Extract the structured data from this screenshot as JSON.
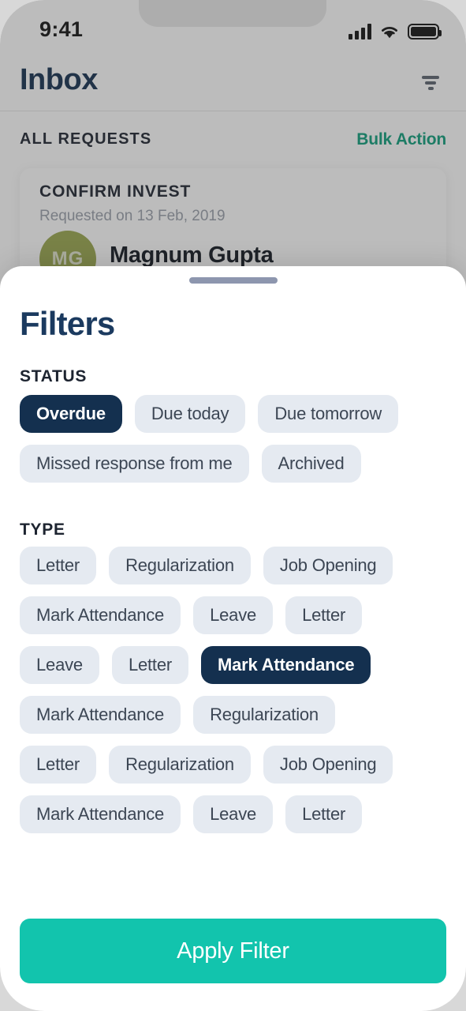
{
  "statusbar": {
    "time": "9:41",
    "signal_icon": "cellular-signal-icon",
    "wifi_icon": "wifi-icon",
    "battery_icon": "battery-icon"
  },
  "inbox": {
    "title": "Inbox",
    "filter_icon": "filter-funnel-icon",
    "list_label": "ALL REQUESTS",
    "bulk_action_label": "Bulk Action",
    "card": {
      "title": "CONFIRM INVEST",
      "subtitle": "Requested on 13 Feb, 2019",
      "avatar_initials": "MG",
      "name": "Magnum Gupta"
    }
  },
  "sheet": {
    "handle": "drag-handle",
    "title": "Filters",
    "sections": [
      {
        "label": "STATUS",
        "rows": [
          [
            {
              "label": "Overdue",
              "selected": true
            },
            {
              "label": "Due today",
              "selected": false
            },
            {
              "label": "Due tomorrow",
              "selected": false
            }
          ],
          [
            {
              "label": "Missed response from me",
              "selected": false
            },
            {
              "label": "Archived",
              "selected": false
            }
          ]
        ]
      },
      {
        "label": "TYPE",
        "rows": [
          [
            {
              "label": "Letter",
              "selected": false
            },
            {
              "label": "Regularization",
              "selected": false
            },
            {
              "label": "Job Opening",
              "selected": false
            }
          ],
          [
            {
              "label": "Mark Attendance",
              "selected": false
            },
            {
              "label": "Leave",
              "selected": false
            },
            {
              "label": "Letter",
              "selected": false
            }
          ],
          [
            {
              "label": "Leave",
              "selected": false
            },
            {
              "label": "Letter",
              "selected": false
            },
            {
              "label": "Mark Attendance",
              "selected": true
            }
          ],
          [
            {
              "label": "Mark Attendance",
              "selected": false
            },
            {
              "label": "Regularization",
              "selected": false
            }
          ],
          [
            {
              "label": "Letter",
              "selected": false
            },
            {
              "label": "Regularization",
              "selected": false
            },
            {
              "label": "Job Opening",
              "selected": false
            }
          ],
          [
            {
              "label": "Mark Attendance",
              "selected": false
            },
            {
              "label": "Leave",
              "selected": false
            },
            {
              "label": "Letter",
              "selected": false
            }
          ]
        ]
      }
    ],
    "apply_label": "Apply Filter"
  },
  "colors": {
    "accent_teal": "#12c4ad",
    "navy_selected": "#14304f",
    "chip_bg": "#e5eaf1",
    "bulk_action_green": "#0f9e7c",
    "handle": "#8d96ae",
    "avatar_bg": "#9aa84e"
  }
}
